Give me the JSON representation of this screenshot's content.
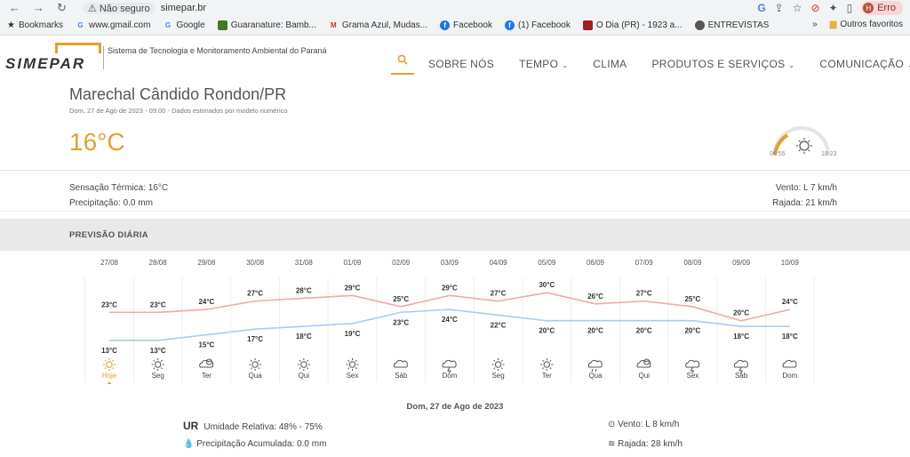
{
  "browser": {
    "security_label": "Não seguro",
    "url": "simepar.br",
    "profile_label": "Erro",
    "profile_initial": "H",
    "bookmarks": [
      {
        "label": "Bookmarks",
        "icon": "star-icon",
        "color": "#555555"
      },
      {
        "label": "www.gmail.com",
        "icon": "google-icon",
        "color": "#4285f4"
      },
      {
        "label": "Google",
        "icon": "google-icon",
        "color": "#4285f4"
      },
      {
        "label": "Guaranature: Bamb...",
        "icon": "leaf-icon",
        "color": "#3f7d20"
      },
      {
        "label": "Grama Azul, Mudas...",
        "icon": "gmail-icon",
        "color": "#d93025"
      },
      {
        "label": "Facebook",
        "icon": "facebook-icon",
        "color": "#1877f2"
      },
      {
        "label": "(1) Facebook",
        "icon": "facebook-icon",
        "color": "#1877f2"
      },
      {
        "label": "O Dia (PR) - 1923 a...",
        "icon": "news-icon",
        "color": "#a02020"
      },
      {
        "label": "ENTREVISTAS",
        "icon": "globe-icon",
        "color": "#555555"
      }
    ],
    "more_bookmarks": "»",
    "other_favorites": "Outros favoritos"
  },
  "site": {
    "logo_text": "SIMEPAR",
    "org_name": "Sistema de Tecnologia e Monitoramento Ambiental do Paraná",
    "menu": [
      {
        "label": "SOBRE NÓS",
        "has_dropdown": false
      },
      {
        "label": "TEMPO",
        "has_dropdown": true
      },
      {
        "label": "CLIMA",
        "has_dropdown": false
      },
      {
        "label": "PRODUTOS E SERVIÇOS",
        "has_dropdown": true
      },
      {
        "label": "COMUNICAÇÃO",
        "has_dropdown": true
      }
    ],
    "accent_color": "#e3a02d"
  },
  "location": {
    "city": "Marechal Cândido Rondon/PR",
    "subtitle": "Dom, 27 de Ago de 2023 - 09:00 - Dados estimados por modelo numérico",
    "temperature": "16°C",
    "sunrise": "06:55",
    "sunset": "18:23"
  },
  "current": {
    "feels_like": "Sensação Térmica: 16°C",
    "precipitation": "Precipitação: 0.0 mm",
    "wind": "Vento: L 7 km/h",
    "gust": "Rajada: 21 km/h"
  },
  "daily_title": "PREVISÃO DIÁRIA",
  "chart_data": {
    "type": "line",
    "categories": [
      "27/08",
      "28/08",
      "29/08",
      "30/08",
      "31/08",
      "01/09",
      "02/09",
      "03/09",
      "04/09",
      "05/09",
      "06/09",
      "07/09",
      "08/09",
      "09/09",
      "10/09"
    ],
    "weekdays": [
      "Hoje",
      "Seg",
      "Ter",
      "Qua",
      "Qui",
      "Sex",
      "Sáb",
      "Dom",
      "Seg",
      "Ter",
      "Qua",
      "Qui",
      "Sex",
      "Sáb",
      "Dom"
    ],
    "icons": [
      "sun-icon",
      "sun-icon",
      "cloud-sun-icon",
      "sun-icon",
      "sun-icon",
      "sun-icon",
      "cloud-icon",
      "storm-icon",
      "sun-icon",
      "sun-icon",
      "rain-icon",
      "cloud-sun-icon",
      "storm-icon",
      "storm-icon",
      "cloud-icon"
    ],
    "series": [
      {
        "values": [
          23,
          23,
          24,
          27,
          28,
          29,
          25,
          29,
          27,
          30,
          26,
          27,
          25,
          20,
          24
        ],
        "color": "#f2a8a8"
      },
      {
        "values": [
          13,
          13,
          15,
          17,
          18,
          19,
          23,
          24,
          22,
          20,
          20,
          20,
          20,
          18,
          18
        ],
        "color": "#a8cdef"
      }
    ],
    "unit": "°C"
  },
  "detail": {
    "date": "Dom, 27 de Ago de 2023",
    "ur_label": "UR",
    "humidity": "Umidade Relativa: 48% - 75%",
    "precip_acc": "Precipitação Acumulada: 0.0 mm",
    "wind": "Vento: L 8 km/h",
    "gust": "Rajada: 28 km/h"
  }
}
